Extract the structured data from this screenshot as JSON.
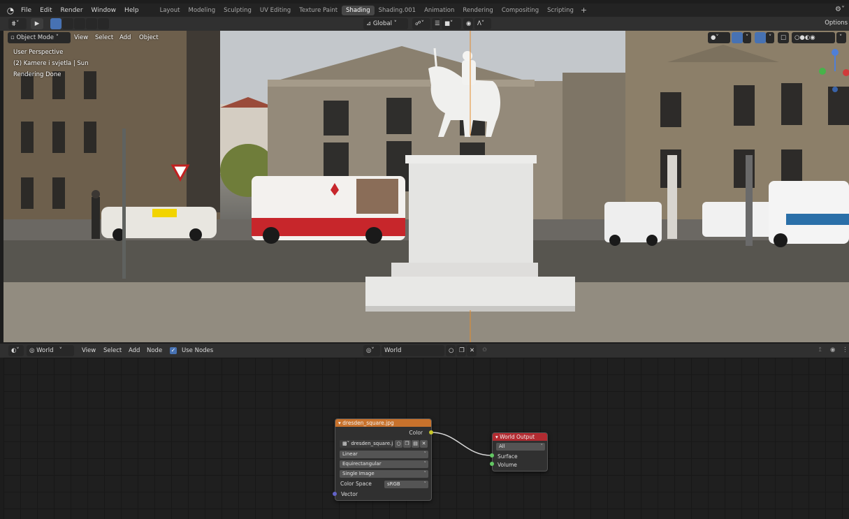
{
  "menubar": {
    "items": [
      "File",
      "Edit",
      "Render",
      "Window",
      "Help"
    ],
    "workspaces": [
      "Layout",
      "Modeling",
      "Sculpting",
      "UV Editing",
      "Texture Paint",
      "Shading",
      "Shading.001",
      "Animation",
      "Rendering",
      "Compositing",
      "Scripting"
    ],
    "active_workspace": "Shading"
  },
  "viewport_header": {
    "transform_orientation": "Global",
    "options_label": "Options",
    "mode": "Object Mode",
    "menus": [
      "View",
      "Select",
      "Add",
      "Object"
    ]
  },
  "viewport_overlay": {
    "perspective": "User Perspective",
    "collection": "(2) Kamere i svjetla | Sun",
    "status": "Rendering Done"
  },
  "node_header": {
    "shader_type": "World",
    "menus": [
      "View",
      "Select",
      "Add",
      "Node"
    ],
    "use_nodes_label": "Use Nodes",
    "world_name": "World"
  },
  "image_node": {
    "title": "dresden_square.jpg",
    "output_color": "Color",
    "image_name": "dresden_square.j...",
    "interpolation": "Linear",
    "projection": "Equirectangular",
    "source": "Single Image",
    "color_space_label": "Color Space",
    "color_space_value": "sRGB",
    "input_vector": "Vector"
  },
  "output_node": {
    "title": "World Output",
    "target": "All",
    "input_surface": "Surface",
    "input_volume": "Volume"
  },
  "colors": {
    "active_tab": "#474747",
    "image_node_header": "#c8722c",
    "output_node_header": "#b22b31",
    "color_socket": "#c7c729",
    "shader_socket": "#63c763",
    "vector_socket": "#6363c7",
    "accent_blue": "#4772b3"
  }
}
